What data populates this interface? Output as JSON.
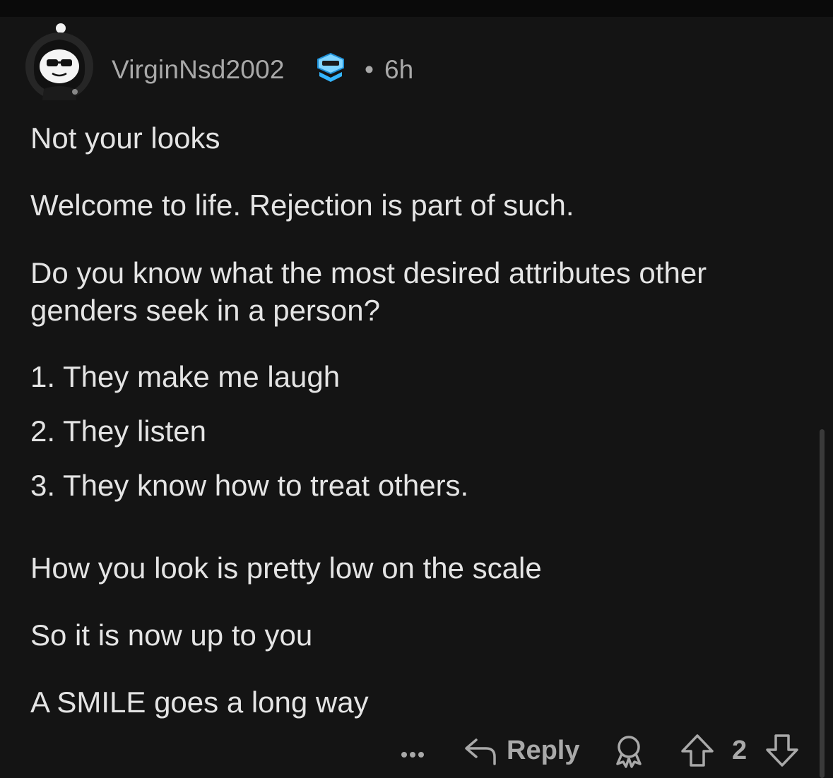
{
  "comment": {
    "username": "VirginNsd2002",
    "separator": "•",
    "time": "6h",
    "avatar_icon": "snoo-avatar-sunglasses-icon",
    "flair_icon": "achievement-flair-icon",
    "paragraphs": [
      "Not your looks",
      "Welcome to life. Rejection is part of such.",
      "Do you know what the most desired attributes other",
      "genders seek in a person?",
      "1. They make me laugh",
      "2. They listen",
      "3. They know how to treat others.",
      "How you look is pretty low on the scale",
      "So it is now up to you",
      "A SMILE  goes a long way"
    ]
  },
  "actions": {
    "more_icon": "more-options-icon",
    "reply_icon": "reply-arrow-icon",
    "reply_label": "Reply",
    "award_icon": "award-icon",
    "upvote_icon": "upvote-arrow-icon",
    "score": "2",
    "downvote_icon": "downvote-arrow-icon"
  },
  "colors": {
    "background": "#141414",
    "text": "#e4e4e4",
    "meta": "#a9a9a9",
    "flair_accent": "#34b5ff"
  }
}
